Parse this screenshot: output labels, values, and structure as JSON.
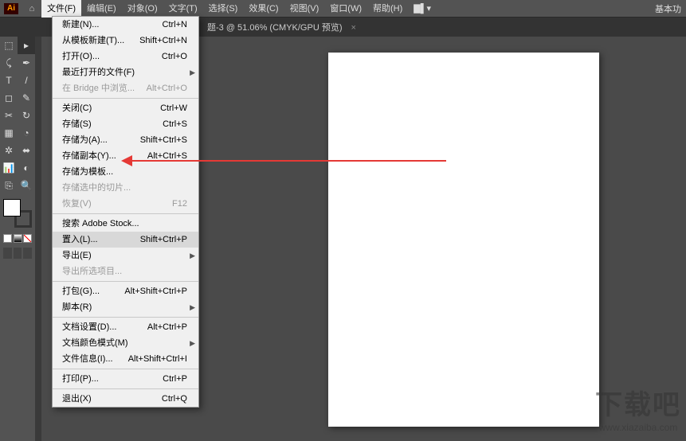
{
  "app": {
    "logo_text": "Ai",
    "right_title": "基本功"
  },
  "menubar": [
    {
      "label": "文件(F)",
      "active": true
    },
    {
      "label": "编辑(E)"
    },
    {
      "label": "对象(O)"
    },
    {
      "label": "文字(T)"
    },
    {
      "label": "选择(S)"
    },
    {
      "label": "效果(C)"
    },
    {
      "label": "视图(V)"
    },
    {
      "label": "窗口(W)"
    },
    {
      "label": "帮助(H)"
    },
    {
      "label": "▇▌▾"
    }
  ],
  "tab": {
    "title": "题-3 @ 51.06% (CMYK/GPU 预览)",
    "close": "×"
  },
  "menu_groups": [
    [
      {
        "label": "新建(N)...",
        "shortcut": "Ctrl+N"
      },
      {
        "label": "从模板新建(T)...",
        "shortcut": "Shift+Ctrl+N"
      },
      {
        "label": "打开(O)...",
        "shortcut": "Ctrl+O"
      },
      {
        "label": "最近打开的文件(F)",
        "shortcut": "",
        "submenu": true
      },
      {
        "label": "在 Bridge 中浏览...",
        "shortcut": "Alt+Ctrl+O",
        "disabled": true
      }
    ],
    [
      {
        "label": "关闭(C)",
        "shortcut": "Ctrl+W"
      },
      {
        "label": "存储(S)",
        "shortcut": "Ctrl+S"
      },
      {
        "label": "存储为(A)...",
        "shortcut": "Shift+Ctrl+S"
      },
      {
        "label": "存储副本(Y)...",
        "shortcut": "Alt+Ctrl+S"
      },
      {
        "label": "存储为模板...",
        "shortcut": ""
      },
      {
        "label": "存储选中的切片...",
        "shortcut": "",
        "disabled": true
      },
      {
        "label": "恢复(V)",
        "shortcut": "F12",
        "disabled": true
      }
    ],
    [
      {
        "label": "搜索 Adobe Stock...",
        "shortcut": ""
      },
      {
        "label": "置入(L)...",
        "shortcut": "Shift+Ctrl+P",
        "hovered": true
      },
      {
        "label": "导出(E)",
        "shortcut": "",
        "submenu": true
      },
      {
        "label": "导出所选项目...",
        "shortcut": "",
        "disabled": true
      }
    ],
    [
      {
        "label": "打包(G)...",
        "shortcut": "Alt+Shift+Ctrl+P"
      },
      {
        "label": "脚本(R)",
        "shortcut": "",
        "submenu": true
      }
    ],
    [
      {
        "label": "文档设置(D)...",
        "shortcut": "Alt+Ctrl+P"
      },
      {
        "label": "文档颜色模式(M)",
        "shortcut": "",
        "submenu": true
      },
      {
        "label": "文件信息(I)...",
        "shortcut": "Alt+Shift+Ctrl+I"
      }
    ],
    [
      {
        "label": "打印(P)...",
        "shortcut": "Ctrl+P"
      }
    ],
    [
      {
        "label": "退出(X)",
        "shortcut": "Ctrl+Q"
      }
    ]
  ],
  "tools": [
    "⬚",
    "▸",
    "⤹",
    "✒",
    "T",
    "/",
    "◻",
    "✎",
    "✂",
    "↻",
    "▦",
    "◔",
    "✲",
    "⬌",
    "📊",
    "◐",
    "⎘",
    "🔍"
  ],
  "watermark": {
    "big": "下载吧",
    "url": "www.xiazaiba.com"
  }
}
